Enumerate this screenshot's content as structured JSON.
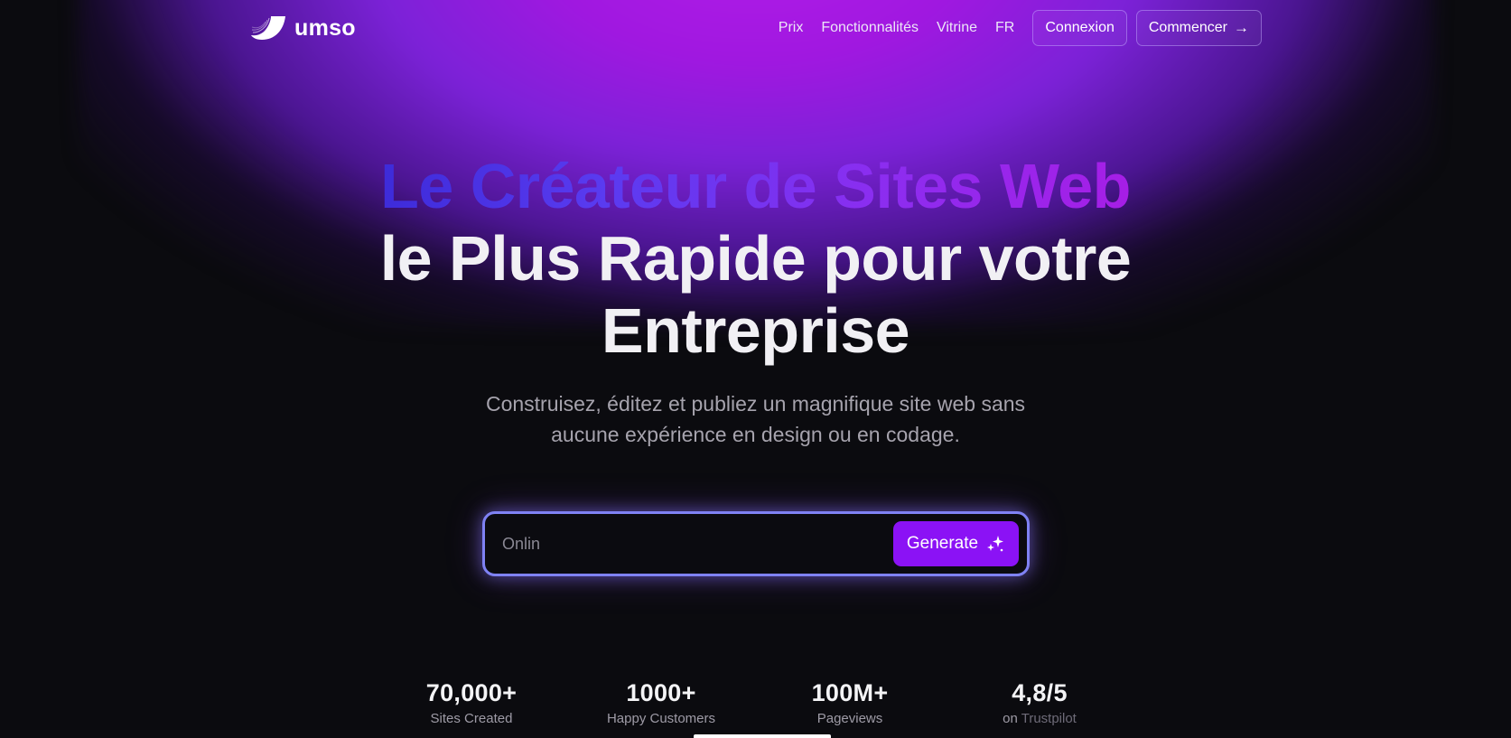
{
  "nav": {
    "logo_text": "umso",
    "links": [
      "Prix",
      "Fonctionnalités",
      "Vitrine",
      "FR"
    ],
    "login_label": "Connexion",
    "start_label": "Commencer",
    "start_arrow": "→"
  },
  "hero": {
    "title_line1": "Le Créateur de Sites Web",
    "title_line2": "le Plus Rapide pour votre",
    "title_line3": "Entreprise",
    "subtitle": "Construisez, éditez et publiez un magnifique site web sans aucune expérience en design ou en codage."
  },
  "prompt": {
    "value": "Onlin",
    "button_label": "Generate",
    "button_icon": "sparkles-icon"
  },
  "stats": [
    {
      "value": "70,000+",
      "label": "Sites Created"
    },
    {
      "value": "1000+",
      "label": "Happy Customers"
    },
    {
      "value": "100M+",
      "label": "Pageviews"
    },
    {
      "value": "4,8/5",
      "label_prefix": "on ",
      "label_link": "Trustpilot"
    }
  ],
  "colors": {
    "accent": "#8b12f5",
    "prompt_border": "#7f82f4",
    "glow": "#b21ce8"
  }
}
